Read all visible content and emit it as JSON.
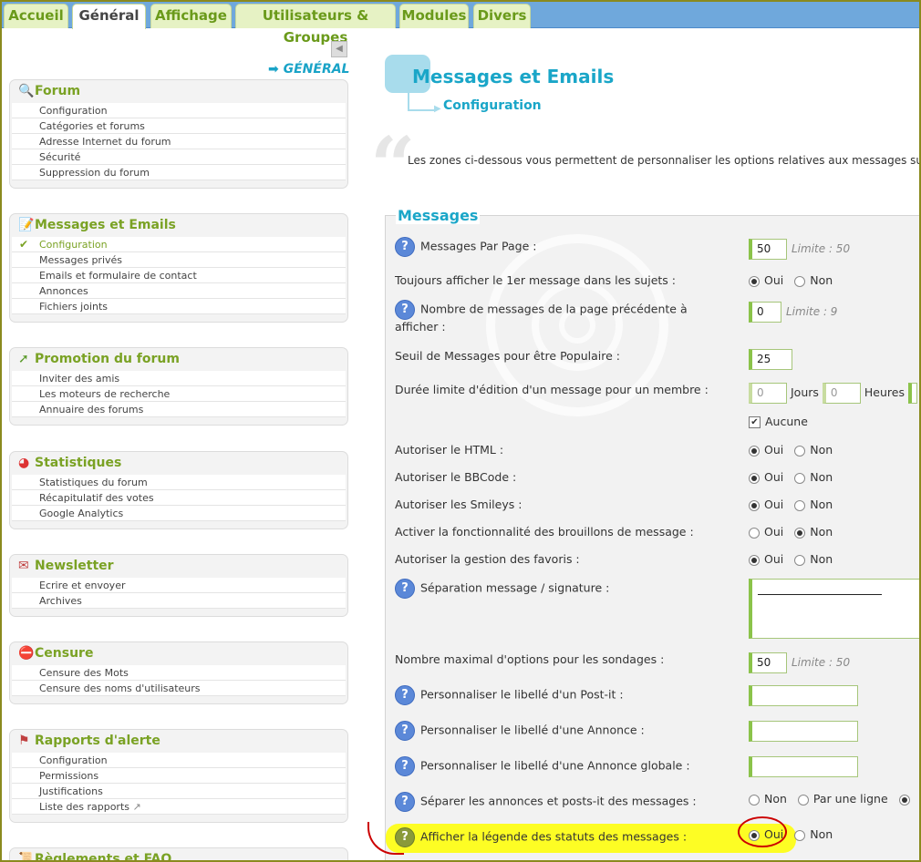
{
  "tabs": [
    "Accueil",
    "Général",
    "Affichage",
    "Utilisateurs & Groupes",
    "Modules",
    "Divers"
  ],
  "sidebar": {
    "collapse_icon": "◀",
    "section_label": "➡ GÉNÉRAL",
    "boxes": [
      {
        "title": "Forum",
        "icon": "key-icon",
        "items": [
          "Configuration",
          "Catégories et forums",
          "Adresse Internet du forum",
          "Sécurité",
          "Suppression du forum"
        ]
      },
      {
        "title": "Messages et Emails",
        "icon": "note-icon",
        "items": [
          "Configuration",
          "Messages privés",
          "Emails et formulaire de contact",
          "Annonces",
          "Fichiers joints"
        ]
      },
      {
        "title": "Promotion du forum",
        "icon": "arrow-icon",
        "items": [
          "Inviter des amis",
          "Les moteurs de recherche",
          "Annuaire des forums"
        ]
      },
      {
        "title": "Statistiques",
        "icon": "pie-chart-icon",
        "items": [
          "Statistiques du forum",
          "Récapitulatif des votes",
          "Google Analytics"
        ]
      },
      {
        "title": "Newsletter",
        "icon": "mail-icon",
        "items": [
          "Ecrire et envoyer",
          "Archives"
        ]
      },
      {
        "title": "Censure",
        "icon": "forbidden-icon",
        "items": [
          "Censure des Mots",
          "Censure des noms d'utilisateurs"
        ]
      },
      {
        "title": "Rapports d'alerte",
        "icon": "alert-icon",
        "items": [
          "Configuration",
          "Permissions",
          "Justifications",
          "Liste des rapports"
        ]
      },
      {
        "title": "Règlements et FAQ",
        "icon": "book-icon",
        "items": []
      }
    ]
  },
  "main": {
    "title": "Messages et Emails",
    "subtitle": "Configuration",
    "intro": "Les zones ci-dessous vous permettent de personnaliser les options relatives aux messages sur le",
    "legend": "Messages",
    "help_icon": "?",
    "fields": {
      "per_page": {
        "label": "Messages Par Page :",
        "value": "50",
        "limit": "Limite : 50"
      },
      "first_msg": {
        "label": "Toujours afficher le 1er message dans les sujets :",
        "yes": "Oui",
        "no": "Non"
      },
      "prev_page": {
        "label1": "Nombre de messages de la page précédente à",
        "label2": "afficher :",
        "value": "0",
        "limit": "Limite : 9"
      },
      "popular": {
        "label": "Seuil de Messages pour être Populaire :",
        "value": "25"
      },
      "edit_limit": {
        "label": "Durée limite d'édition d'un message pour un membre :",
        "days_value": "0",
        "days": "Jours",
        "hours_value": "0",
        "hours": "Heures",
        "none": "Aucune"
      },
      "html": {
        "label": "Autoriser le HTML :",
        "yes": "Oui",
        "no": "Non"
      },
      "bbcode": {
        "label": "Autoriser le BBCode :",
        "yes": "Oui",
        "no": "Non"
      },
      "smileys": {
        "label": "Autoriser les Smileys :",
        "yes": "Oui",
        "no": "Non"
      },
      "drafts": {
        "label": "Activer la fonctionnalité des brouillons de message :",
        "yes": "Oui",
        "no": "Non"
      },
      "favorites": {
        "label": "Autoriser la gestion des favoris :",
        "yes": "Oui",
        "no": "Non"
      },
      "signature": {
        "label": "Séparation message / signature :"
      },
      "poll_options": {
        "label": "Nombre maximal d'options pour les sondages :",
        "value": "50",
        "limit": "Limite : 50"
      },
      "postit_label": {
        "label": "Personnaliser le libellé d'un Post-it :"
      },
      "announce_label": {
        "label": "Personnaliser le libellé d'une Annonce :"
      },
      "global_label": {
        "label": "Personnaliser le libellé d'une Annonce globale :"
      },
      "separate": {
        "label": "Séparer les annonces et posts-it des messages :",
        "opt1": "Non",
        "opt2": "Par une ligne"
      },
      "legend_status": {
        "label": "Afficher la légende des statuts des messages :",
        "yes": "Oui",
        "no": "Non"
      }
    }
  }
}
